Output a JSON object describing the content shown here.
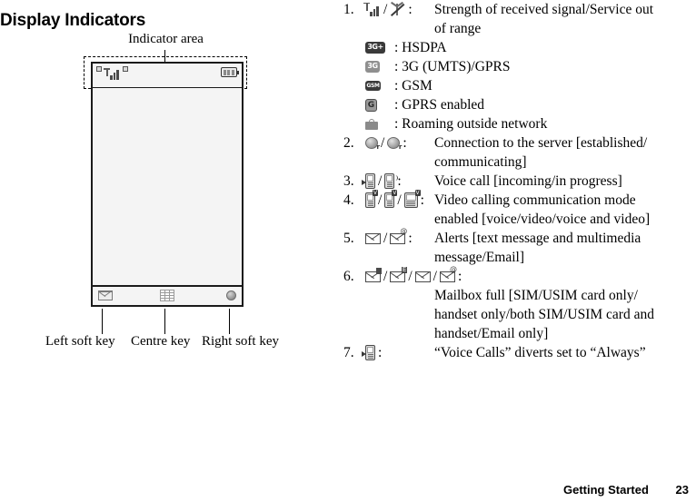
{
  "page_title": "Display Indicators",
  "diagram": {
    "indicator_area_label": "Indicator area",
    "key_labels": {
      "left": "Left soft key",
      "centre": "Centre key",
      "right": "Right soft key"
    },
    "status_icons": [
      "alert-icon",
      "signal-bars-icon",
      "small-box-icon"
    ],
    "battery_icon": "battery-icon",
    "softkeys": {
      "left_icon": "envelope-icon",
      "centre_icon": "keypad-grid-icon",
      "right_icon": "globe-icon"
    }
  },
  "indicators": [
    {
      "num": "1.",
      "icons": [
        "signal-bars-icon",
        "/",
        "service-out-of-range-icon",
        ":"
      ],
      "desc": "Strength of received signal/Service out",
      "desc_cont": "of range",
      "sublines": [
        {
          "icon": "hsdpa-badge-icon",
          "text": ": HSDPA",
          "label": "3G+"
        },
        {
          "icon": "3g-badge-icon",
          "text": ": 3G (UMTS)/GPRS",
          "label": "3G"
        },
        {
          "icon": "gsm-badge-icon",
          "text": ": GSM",
          "label": "GSM"
        },
        {
          "icon": "gprs-badge-icon",
          "text": ": GPRS enabled",
          "label": "G"
        },
        {
          "icon": "roaming-icon",
          "text": ": Roaming outside network",
          "label": ""
        }
      ]
    },
    {
      "num": "2.",
      "icons": [
        "server-connection-established-icon",
        "/",
        "server-connection-communicating-icon",
        ":"
      ],
      "desc": "Connection to the server [established/",
      "desc_cont": "communicating]"
    },
    {
      "num": "3.",
      "icons": [
        "voice-call-incoming-icon",
        "/",
        "voice-call-in-progress-icon",
        ":"
      ],
      "desc": "Voice call [incoming/in progress]"
    },
    {
      "num": "4.",
      "icons": [
        "video-call-voice-icon",
        "/",
        "video-call-video-icon",
        "/",
        "video-call-voice-and-video-icon",
        ":"
      ],
      "desc": "Video calling communication mode",
      "desc_cont": "enabled [voice/video/voice and video]"
    },
    {
      "num": "5.",
      "icons": [
        "text-message-alert-icon",
        "/",
        "email-alert-icon",
        ":"
      ],
      "desc": "Alerts [text message and multimedia",
      "desc_cont": "message/Email]"
    },
    {
      "num": "6.",
      "icons": [
        "mailbox-full-sim-icon",
        "/",
        "mailbox-full-handset-icon",
        "/",
        "mailbox-full-both-icon",
        "/",
        "mailbox-full-email-icon",
        ":"
      ],
      "desc": "",
      "desc_lines": [
        "Mailbox full [SIM/USIM card only/",
        "handset only/both SIM/USIM card and",
        "handset/Email only]"
      ]
    },
    {
      "num": "7.",
      "icons": [
        "voice-call-divert-icon",
        ":"
      ],
      "desc": "“Voice Calls” diverts set to “Always”"
    }
  ],
  "footer": {
    "section": "Getting Started",
    "page_number": "23"
  }
}
